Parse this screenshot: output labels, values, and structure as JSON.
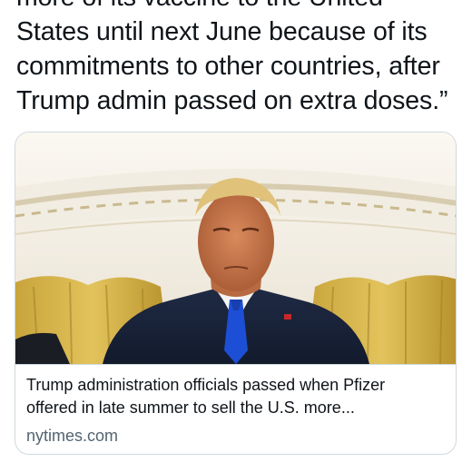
{
  "tweet": {
    "text_lines": [
      "more of its vaccine to the United",
      "States until next June because of its",
      "commitments to other countries, after",
      "Trump admin passed on extra doses.”"
    ]
  },
  "link_card": {
    "image_alt": "Donald Trump standing in the Oval Office",
    "title_lines": [
      "Trump administration officials passed when Pfizer",
      "offered in late summer to sell the U.S. more..."
    ],
    "domain": "nytimes.com"
  },
  "colors": {
    "text": "#0f1419",
    "secondary_text": "#536471",
    "border": "#cfd9de"
  }
}
